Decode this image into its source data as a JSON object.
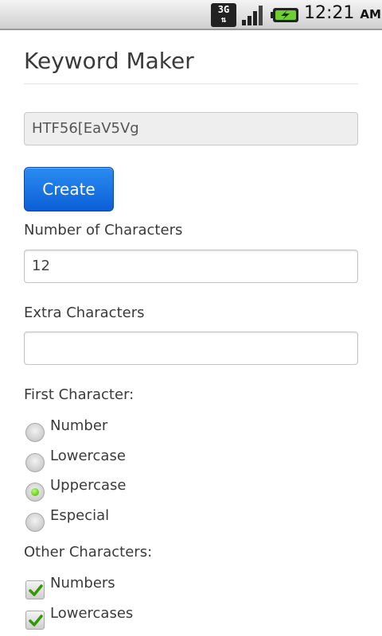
{
  "status_bar": {
    "network_type": "3G",
    "network_arrows": "⇅",
    "time": "12:21",
    "ampm": "AM"
  },
  "app": {
    "title": "Keyword Maker"
  },
  "result": {
    "value": "HTF56[EaV5Vg"
  },
  "create_button": {
    "label": "Create"
  },
  "num_chars": {
    "label": "Number of Characters",
    "value": "12"
  },
  "extra_chars": {
    "label": "Extra Characters",
    "value": ""
  },
  "first_character": {
    "label": "First Character:",
    "options": [
      {
        "label": "Number",
        "selected": false
      },
      {
        "label": "Lowercase",
        "selected": false
      },
      {
        "label": "Uppercase",
        "selected": true
      },
      {
        "label": "Especial",
        "selected": false
      }
    ]
  },
  "other_characters": {
    "label": "Other Characters:",
    "options": [
      {
        "label": "Numbers",
        "checked": true
      },
      {
        "label": "Lowercases",
        "checked": true
      }
    ]
  },
  "colors": {
    "button_blue": "#0b5fd6",
    "radio_green": "#3fb400",
    "check_green": "#2f9b00"
  }
}
